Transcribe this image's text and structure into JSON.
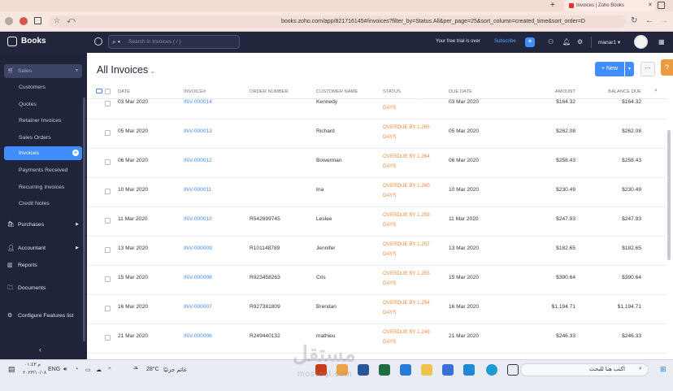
{
  "browser": {
    "tab_title": "Invoices | Zoho Books",
    "url": "books.zoho.com/app/821716145#/invoices?filter_by=Status.All&per_page=25&sort_column=created_time&sort_order=D"
  },
  "header": {
    "brand": "Books",
    "search_placeholder": "Search in Invoices ( / )",
    "trial_text": "Your free trial is over",
    "subscribe_label": "Subscribe",
    "org_name": "manar1"
  },
  "sidebar": {
    "sales_label": "Sales",
    "sales_items": [
      {
        "label": "Customers"
      },
      {
        "label": "Quotes"
      },
      {
        "label": "Retainer Invoices"
      },
      {
        "label": "Sales Orders"
      },
      {
        "label": "Invoices"
      },
      {
        "label": "Payments Received"
      },
      {
        "label": "Recurring Invoices"
      },
      {
        "label": "Credit Notes"
      }
    ],
    "purchases_label": "Purchases",
    "accountant_label": "Accountant",
    "reports_label": "Reports",
    "documents_label": "Documents",
    "configure_label": "Configure Features list"
  },
  "main": {
    "title": "All Invoices",
    "new_label": "+ New",
    "columns": [
      "DATE",
      "INVOICE#",
      "ORDER NUMBER",
      "CUSTOMER NAME",
      "STATUS",
      "DUE DATE",
      "AMOUNT",
      "BALANCE DUE"
    ],
    "rows": [
      {
        "date": "03 Mar 2020",
        "invoice": "INV-000014",
        "order": "",
        "customer": "Kennedy",
        "status1": "OVERDUE BY 1,267",
        "status2": "DAYS",
        "due": "03 Mar 2020",
        "amount": "$164.32",
        "balance": "$164.32"
      },
      {
        "date": "05 Mar 2020",
        "invoice": "INV-000013",
        "order": "",
        "customer": "Richard",
        "status1": "OVERDUE BY 1,265",
        "status2": "DAYS",
        "due": "05 Mar 2020",
        "amount": "$262.08",
        "balance": "$262.08"
      },
      {
        "date": "06 Mar 2020",
        "invoice": "INV-000012",
        "order": "",
        "customer": "Bowerman",
        "status1": "OVERDUE BY 1,264",
        "status2": "DAYS",
        "due": "06 Mar 2020",
        "amount": "$258.43",
        "balance": "$258.43"
      },
      {
        "date": "10 Mar 2020",
        "invoice": "INV-000011",
        "order": "",
        "customer": "Ina",
        "status1": "OVERDUE BY 1,260",
        "status2": "DAYS",
        "due": "10 Mar 2020",
        "amount": "$230.49",
        "balance": "$230.49"
      },
      {
        "date": "11 Mar 2020",
        "invoice": "INV-000010",
        "order": "R542699745",
        "customer": "Leslee",
        "status1": "OVERDUE BY 1,259",
        "status2": "DAYS",
        "due": "11 Mar 2020",
        "amount": "$247.93",
        "balance": "$247.93"
      },
      {
        "date": "13 Mar 2020",
        "invoice": "INV-000009",
        "order": "R101148789",
        "customer": "Jennifer",
        "status1": "OVERDUE BY 1,257",
        "status2": "DAYS",
        "due": "13 Mar 2020",
        "amount": "$182.65",
        "balance": "$182.65"
      },
      {
        "date": "15 Mar 2020",
        "invoice": "INV-000008",
        "order": "R923458263",
        "customer": "Cris",
        "status1": "OVERDUE BY 1,255",
        "status2": "DAYS",
        "due": "15 Mar 2020",
        "amount": "$390.64",
        "balance": "$390.64"
      },
      {
        "date": "16 Mar 2020",
        "invoice": "INV-000007",
        "order": "R927381809",
        "customer": "Brendan",
        "status1": "OVERDUE BY 1,254",
        "status2": "DAYS",
        "due": "16 Mar 2020",
        "amount": "$1,194.71",
        "balance": "$1,194.71"
      },
      {
        "date": "21 Mar 2020",
        "invoice": "INV-000006",
        "order": "R249440132",
        "customer": "mathieu",
        "status1": "OVERDUE BY 1,249",
        "status2": "DAYS",
        "due": "21 Mar 2020",
        "amount": "$246.33",
        "balance": "$246.33"
      }
    ]
  },
  "taskbar": {
    "weather": "28°C",
    "weather_text": "غائم جزئيًا",
    "lang": "ENG",
    "time": "م ٠١:٤٣",
    "date": "٢٠٢٣/١٠/٠٨",
    "search_text": "اكتب هنا للبحث",
    "watermark": "مستقل",
    "watermark_sub": "mostaql.com"
  },
  "colors": {
    "accent": "#408dfb",
    "sidebar_bg": "#1f243a",
    "header_bg": "#21263c",
    "overdue": "#f0883e"
  }
}
